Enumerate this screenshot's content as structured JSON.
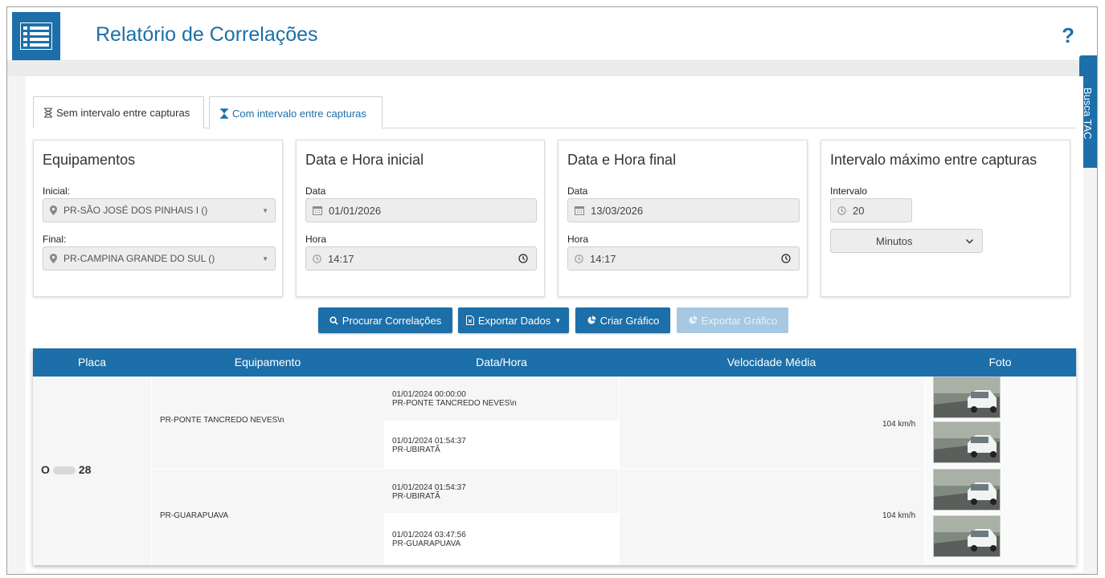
{
  "header": {
    "title": "Relatório de Correlações",
    "help": "?"
  },
  "side_tab": {
    "label": "Busca TAC"
  },
  "tabs": [
    {
      "label": "Sem intervalo entre capturas",
      "active": false
    },
    {
      "label": "Com intervalo entre capturas",
      "active": true
    }
  ],
  "equipamentos": {
    "title": "Equipamentos",
    "inicial_label": "Inicial:",
    "inicial_value": "PR-SÃO JOSÉ DOS PINHAIS I ()",
    "final_label": "Final:",
    "final_value": "PR-CAMPINA GRANDE DO SUL ()"
  },
  "inicio": {
    "title": "Data e Hora inicial",
    "data_label": "Data",
    "data_value": "01/01/2026",
    "hora_label": "Hora",
    "hora_value": "14:17"
  },
  "fim": {
    "title": "Data e Hora final",
    "data_label": "Data",
    "data_value": "13/03/2026",
    "hora_label": "Hora",
    "hora_value": "14:17"
  },
  "intervalo": {
    "title": "Intervalo máximo entre capturas",
    "label": "Intervalo",
    "value": "20",
    "unit": "Minutos"
  },
  "actions": {
    "procurar": "Procurar Correlações",
    "exportar_dados": "Exportar Dados",
    "criar_grafico": "Criar Gráfico",
    "exportar_grafico": "Exportar Gráfico"
  },
  "table": {
    "columns": [
      "Placa",
      "Equipamento",
      "Data/Hora",
      "Velocidade Média",
      "Foto"
    ],
    "plate_start": "O",
    "plate_end": "28",
    "groups": [
      {
        "equipamento": "PR-PONTE TANCREDO NEVES\\n",
        "velocidade": "104 km/h",
        "events": [
          {
            "datetime": "01/01/2024 00:00:00",
            "location": "PR-PONTE TANCREDO NEVES\\n"
          },
          {
            "datetime": "01/01/2024 01:54:37",
            "location": "PR-UBIRATÃ"
          }
        ]
      },
      {
        "equipamento": "PR-GUARAPUAVA",
        "velocidade": "104 km/h",
        "events": [
          {
            "datetime": "01/01/2024 01:54:37",
            "location": "PR-UBIRATÃ"
          },
          {
            "datetime": "01/01/2024 03:47:56",
            "location": "PR-GUARAPUAVA"
          }
        ]
      }
    ]
  },
  "colors": {
    "brand": "#1c6fa8",
    "disabled": "#a7c8e2"
  }
}
